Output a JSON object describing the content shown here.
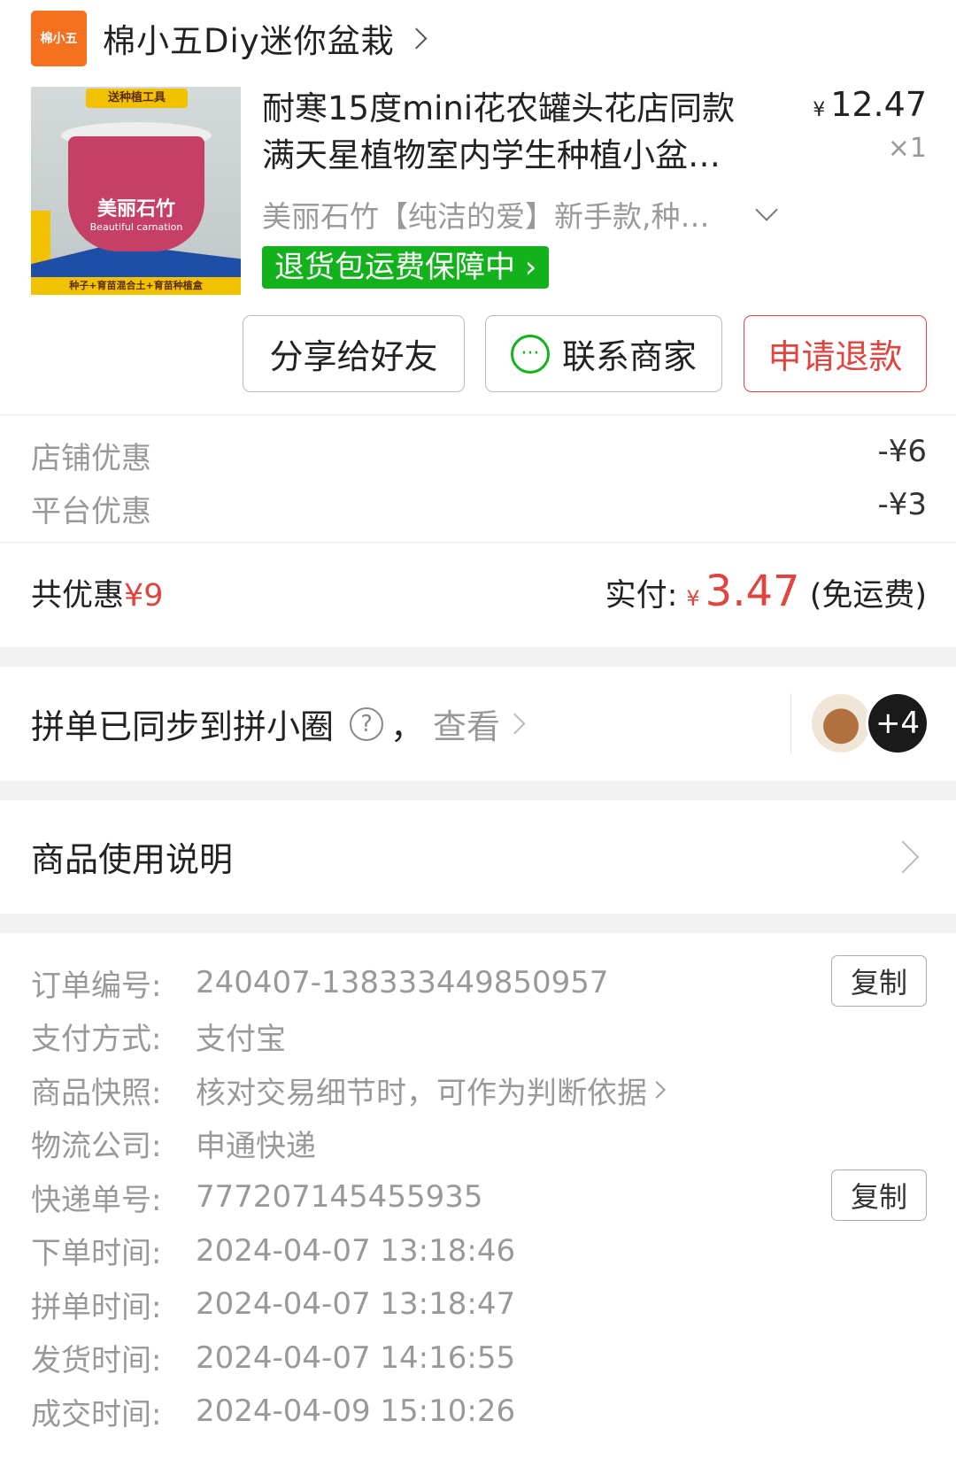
{
  "store": {
    "logo_text": "棉小五",
    "name": "棉小五Diy迷你盆栽"
  },
  "product": {
    "image_tag": "送种植工具",
    "image_main_text": "美丽石竹",
    "image_sub_text": "Beautiful carnation",
    "image_bottom_text": "种子+育苗混合土+育苗种植盒",
    "title": "耐寒15度mini花农罐头花店同款满天星植物室内学生种植小盆…",
    "price_symbol": "¥",
    "price": "12.47",
    "quantity": "×1",
    "sku": "美丽石竹【纯洁的爱】新手款,种…",
    "guarantee": "退货包运费保障中"
  },
  "actions": {
    "share": "分享给好友",
    "contact": "联系商家",
    "refund": "申请退款"
  },
  "discounts": [
    {
      "label": "店铺优惠",
      "value": "-¥6"
    },
    {
      "label": "平台优惠",
      "value": "-¥3"
    }
  ],
  "summary": {
    "total_discount_label": "共优惠",
    "total_discount_value": "¥9",
    "paid_label": "实付:",
    "paid_symbol": "¥",
    "paid_amount": "3.47",
    "shipping_note": "(免运费)"
  },
  "group_sync": {
    "text": "拼单已同步到拼小圈",
    "separator": "，",
    "view": "查看",
    "extra_count": "+4"
  },
  "usage": {
    "label": "商品使用说明"
  },
  "order_info": [
    {
      "label": "订单编号:",
      "value": "240407-138333449850957",
      "copy": "复制"
    },
    {
      "label": "支付方式:",
      "value": "支付宝"
    },
    {
      "label": "商品快照:",
      "value": "核对交易细节时，可作为判断依据",
      "link": true
    },
    {
      "label": "物流公司:",
      "value": "申通快递"
    },
    {
      "label": "快递单号:",
      "value": "777207145455935",
      "copy": "复制"
    },
    {
      "label": "下单时间:",
      "value": "2024-04-07 13:18:46"
    },
    {
      "label": "拼单时间:",
      "value": "2024-04-07 13:18:47"
    },
    {
      "label": "发货时间:",
      "value": "2024-04-07 14:16:55"
    },
    {
      "label": "成交时间:",
      "value": "2024-04-09 15:10:26"
    }
  ],
  "colors": {
    "accent_red": "#e0443e",
    "guarantee_green": "#13b11c",
    "logo_orange": "#f5701f"
  }
}
